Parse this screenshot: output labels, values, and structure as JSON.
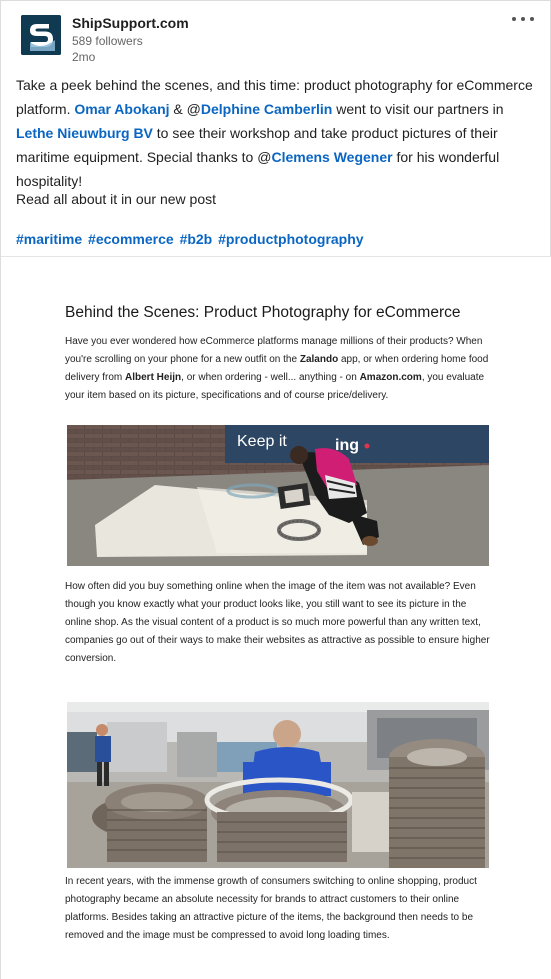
{
  "post": {
    "company_name": "ShipSupport.com",
    "followers": "589 followers",
    "age": "2mo",
    "body": {
      "part1": "Take a peek behind the scenes, and this time: product photography for eCommerce platform. ",
      "mention1": "Omar Abokanj",
      "part2": " & @",
      "mention2": "Delphine Camberlin",
      "part3": " went to visit our partners in ",
      "mention3": "Lethe Nieuwburg BV",
      "part4": " to see their workshop and take product pictures of their maritime equipment. Special thanks to @",
      "mention4": "Clemens Wegener",
      "part5": " for his wonderful hospitality!"
    },
    "read_more": "Read all about it in our new post",
    "hashtags": [
      "#maritime",
      "#ecommerce",
      "#b2b",
      "#productphotography"
    ]
  },
  "article": {
    "title": "Behind the Scenes: Product Photography for eCommerce",
    "p1": {
      "a": "Have you ever wondered how eCommerce platforms manage millions of their products? When you're scrolling on your phone for a new outfit on the ",
      "b1": "Zalando",
      "c": " app, or when ordering home food delivery from ",
      "b2": "Albert Heijn",
      "d": ", or when ordering - well... anything - on ",
      "b3": "Amazon.com",
      "e": ", you evaluate your item based on its picture, specifications and of course price/delivery."
    },
    "photo1_banner_text": "Keep it",
    "photo1_banner_text2": "ing",
    "p2": "How often did you buy something online when the image of the item was not available? Even though you know exactly what your product looks like, you still want to see its picture in the online shop. As the visual content of a product is so much more powerful than any written text, companies go out of their ways to make their websites as attractive as possible to ensure higher conversion.",
    "p3": "In recent years, with the immense growth of consumers switching to online shopping, product photography became an absolute necessity for brands to attract customers to their online platforms. Besides taking an attractive picture of the items, the background then needs to be removed and the image must be compressed to avoid long loading times."
  },
  "colors": {
    "link": "#0a66c2",
    "logo_bg": "#0f3a52"
  },
  "icons": {
    "logo": "shipsupport-logo-icon",
    "more": "more-options-icon"
  }
}
